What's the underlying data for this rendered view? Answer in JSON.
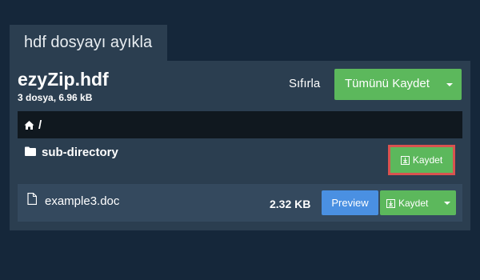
{
  "tab": {
    "title": "hdf dosyayı ayıkla"
  },
  "archive": {
    "name": "ezyZip.hdf",
    "meta": "3 dosya, 6.96 kB"
  },
  "toolbar": {
    "reset_label": "Sıfırla",
    "save_all_label": "Tümünü Kaydet"
  },
  "breadcrumb": {
    "separator": "/"
  },
  "entries": [
    {
      "type": "directory",
      "name": "sub-directory",
      "save_label": "Kaydet"
    },
    {
      "type": "file",
      "name": "example3.doc",
      "size": "2.32 KB",
      "preview_label": "Preview",
      "save_label": "Kaydet"
    }
  ],
  "colors": {
    "background": "#15273a",
    "panel": "#2b3e50",
    "row": "#34495e",
    "success": "#5cb85c",
    "primary": "#4a90e2",
    "highlight": "#d9534f"
  },
  "icons": [
    "home-icon",
    "folder-icon",
    "document-icon",
    "download-icon",
    "chevron-down-icon"
  ]
}
